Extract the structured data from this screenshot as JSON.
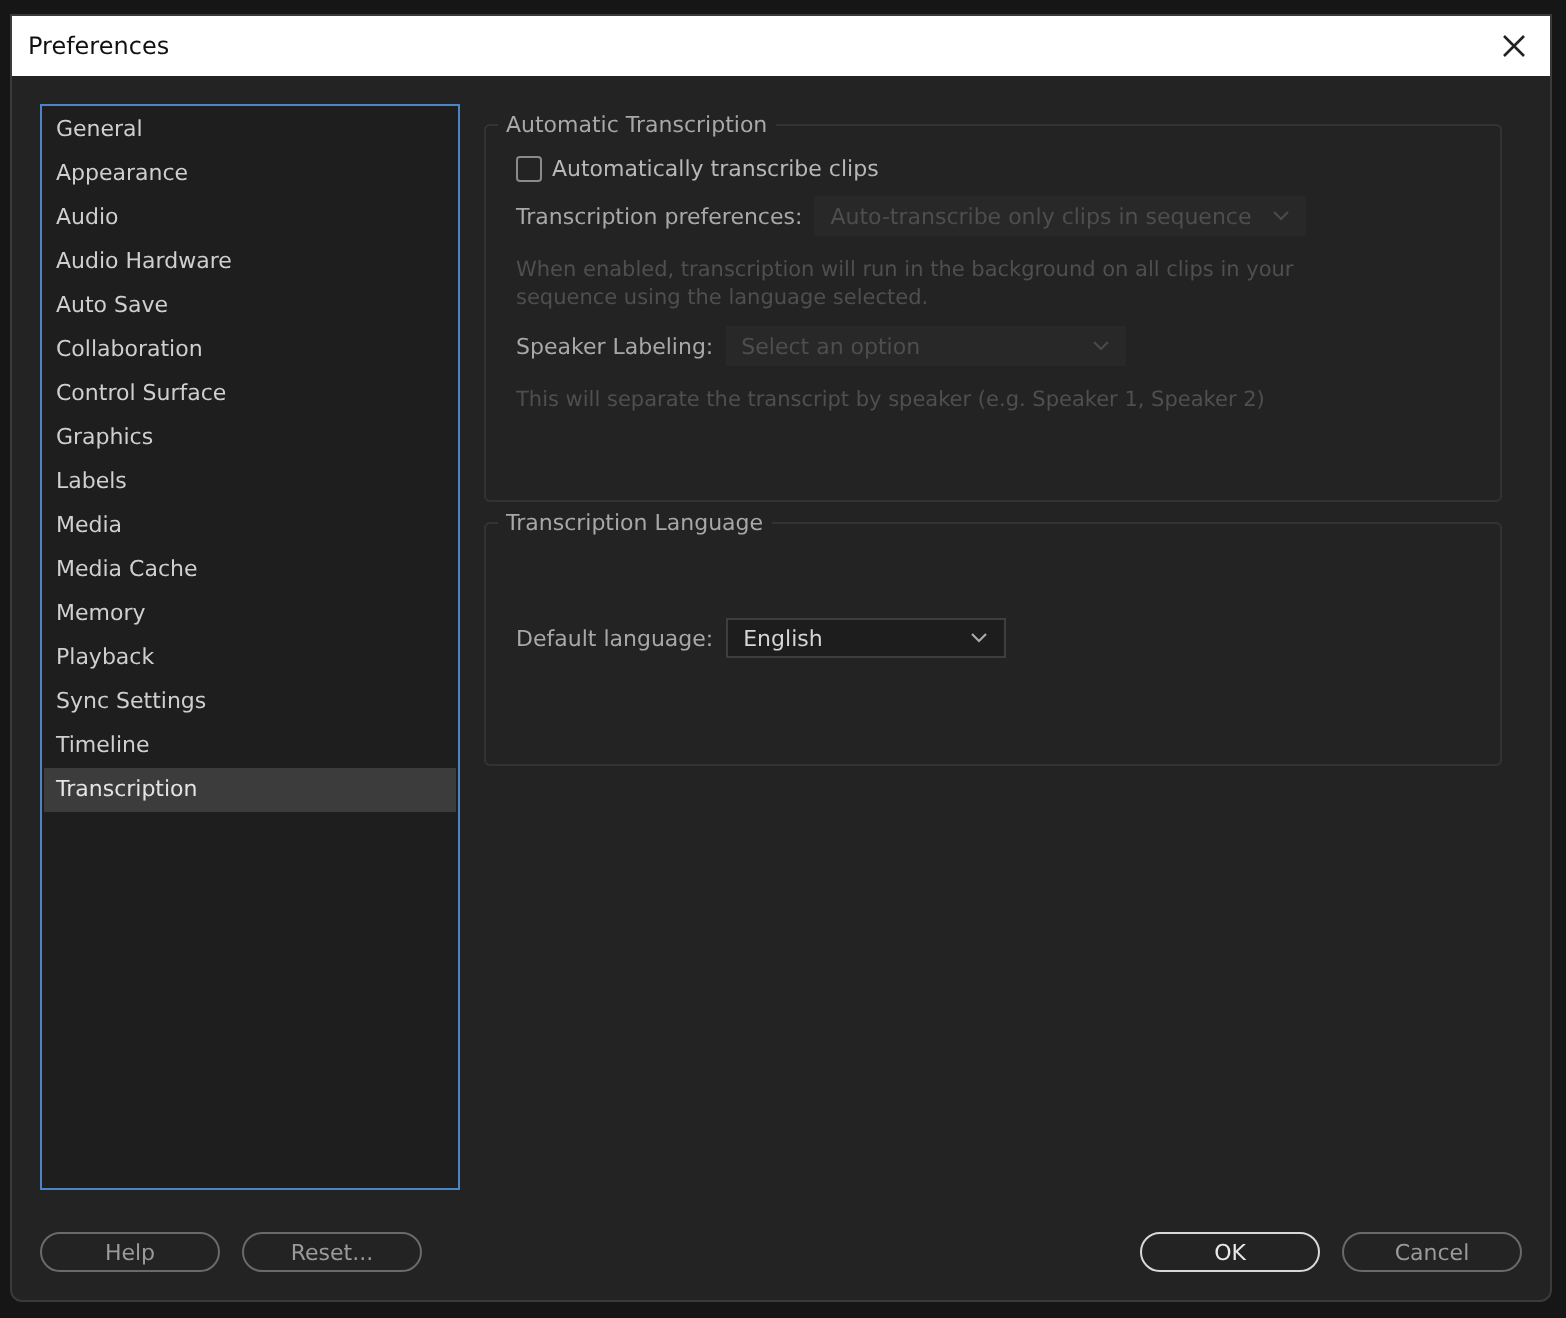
{
  "window": {
    "title": "Preferences"
  },
  "sidebar": {
    "items": [
      {
        "label": "General",
        "selected": false
      },
      {
        "label": "Appearance",
        "selected": false
      },
      {
        "label": "Audio",
        "selected": false
      },
      {
        "label": "Audio Hardware",
        "selected": false
      },
      {
        "label": "Auto Save",
        "selected": false
      },
      {
        "label": "Collaboration",
        "selected": false
      },
      {
        "label": "Control Surface",
        "selected": false
      },
      {
        "label": "Graphics",
        "selected": false
      },
      {
        "label": "Labels",
        "selected": false
      },
      {
        "label": "Media",
        "selected": false
      },
      {
        "label": "Media Cache",
        "selected": false
      },
      {
        "label": "Memory",
        "selected": false
      },
      {
        "label": "Playback",
        "selected": false
      },
      {
        "label": "Sync Settings",
        "selected": false
      },
      {
        "label": "Timeline",
        "selected": false
      },
      {
        "label": "Transcription",
        "selected": true
      }
    ]
  },
  "groups": [
    {
      "title": "Automatic Transcription",
      "rows": [
        {
          "kind": "checkbox",
          "label": "Automatically transcribe clips",
          "checked": false
        },
        {
          "kind": "dropdown",
          "label": "Transcription preferences:",
          "value": "Auto-transcribe only clips in sequence",
          "disabled": true
        },
        {
          "kind": "note",
          "text": "When enabled, transcription will run in the background on all clips in your sequence using the language selected.",
          "disabled": true
        },
        {
          "kind": "dropdown",
          "label": "Speaker Labeling:",
          "value": "Select an option",
          "disabled": true
        },
        {
          "kind": "note",
          "text": "This will separate the transcript by speaker (e.g. Speaker 1, Speaker 2)",
          "disabled": true
        }
      ]
    },
    {
      "title": "Transcription Language",
      "rows": [
        {
          "kind": "dropdown",
          "label": "Default language:",
          "value": "English",
          "disabled": false
        }
      ]
    }
  ],
  "buttons_left": [
    {
      "label": "Help",
      "default": false
    },
    {
      "label": "Reset...",
      "default": false
    }
  ],
  "buttons_right": [
    {
      "label": "OK",
      "default": true
    },
    {
      "label": "Cancel",
      "default": false
    }
  ]
}
